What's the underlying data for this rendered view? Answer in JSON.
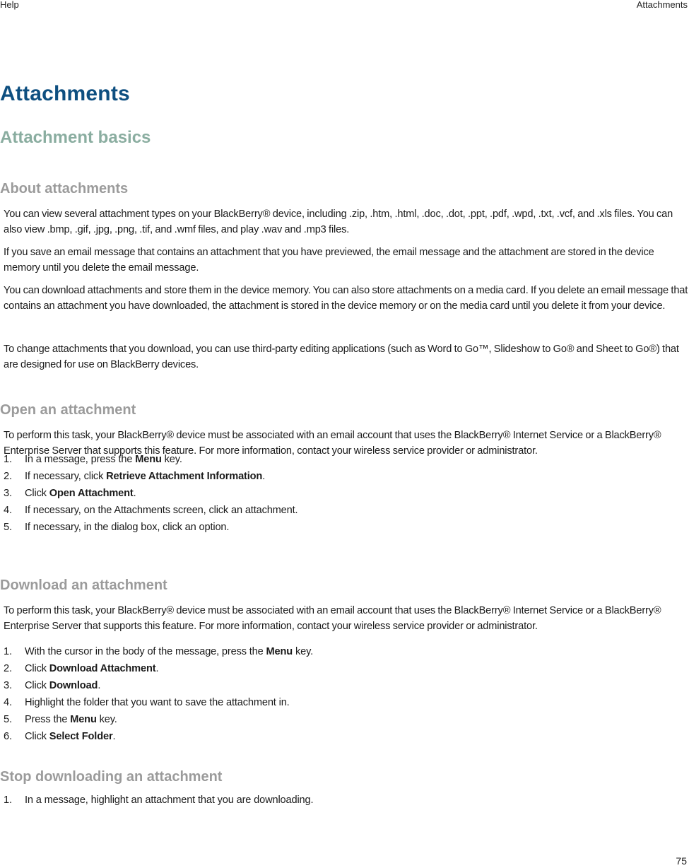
{
  "header": {
    "left": "Help",
    "right": "Attachments"
  },
  "chapter_title": "Attachments",
  "section_title": "Attachment basics",
  "about": {
    "title": "About attachments",
    "paragraphs": [
      "You can view several attachment types on your BlackBerry® device, including .zip, .htm, .html, .doc, .dot, .ppt, .pdf, .wpd, .txt, .vcf, and .xls files. You can also view .bmp, .gif, .jpg, .png, .tif, and .wmf files, and play .wav and .mp3 files.",
      "If you save an email message that contains an attachment that you have previewed, the email message and the attachment are stored in the device memory until you delete the email message.",
      "You can download attachments and store them in the device memory. You can also store attachments on a media card. If you delete an email message that contains an attachment you have downloaded, the attachment is stored in the device memory or on the media card until you delete it from your device.",
      "To change attachments that you download, you can use third-party editing applications (such as Word to Go™, Slideshow to Go® and Sheet to Go®) that are designed for use on BlackBerry devices."
    ]
  },
  "open": {
    "title": "Open an attachment",
    "intro": "To perform this task, your BlackBerry® device must be associated with an email account that uses the BlackBerry® Internet Service or a BlackBerry® Enterprise Server that supports this feature. For more information, contact your wireless service provider or administrator.",
    "steps": [
      {
        "num": "1.",
        "pre": "In a message, press the ",
        "bold": "Menu",
        "post": " key."
      },
      {
        "num": "2.",
        "pre": "If necessary, click ",
        "bold": "Retrieve Attachment Information",
        "post": "."
      },
      {
        "num": "3.",
        "pre": "Click ",
        "bold": "Open Attachment",
        "post": "."
      },
      {
        "num": "4.",
        "pre": "If necessary, on the Attachments screen, click an attachment.",
        "bold": "",
        "post": ""
      },
      {
        "num": "5.",
        "pre": "If necessary, in the dialog box, click an option.",
        "bold": "",
        "post": ""
      }
    ]
  },
  "download": {
    "title": "Download an attachment",
    "intro": "To perform this task, your BlackBerry® device must be associated with an email account that uses the BlackBerry® Internet Service or a BlackBerry® Enterprise Server that supports this feature. For more information, contact your wireless service provider or administrator.",
    "steps": [
      {
        "num": "1.",
        "pre": "With the cursor in the body of the message, press the ",
        "bold": "Menu",
        "post": " key."
      },
      {
        "num": "2.",
        "pre": "Click ",
        "bold": "Download Attachment",
        "post": "."
      },
      {
        "num": "3.",
        "pre": "Click ",
        "bold": "Download",
        "post": "."
      },
      {
        "num": "4.",
        "pre": "Highlight the folder that you want to save the attachment in.",
        "bold": "",
        "post": ""
      },
      {
        "num": "5.",
        "pre": "Press the ",
        "bold": "Menu",
        "post": " key."
      },
      {
        "num": "6.",
        "pre": "Click ",
        "bold": "Select Folder",
        "post": "."
      }
    ]
  },
  "stop": {
    "title": "Stop downloading an attachment",
    "steps": [
      {
        "num": "1.",
        "pre": "In a message, highlight an attachment that you are downloading.",
        "bold": "",
        "post": ""
      }
    ]
  },
  "page_number": "75"
}
